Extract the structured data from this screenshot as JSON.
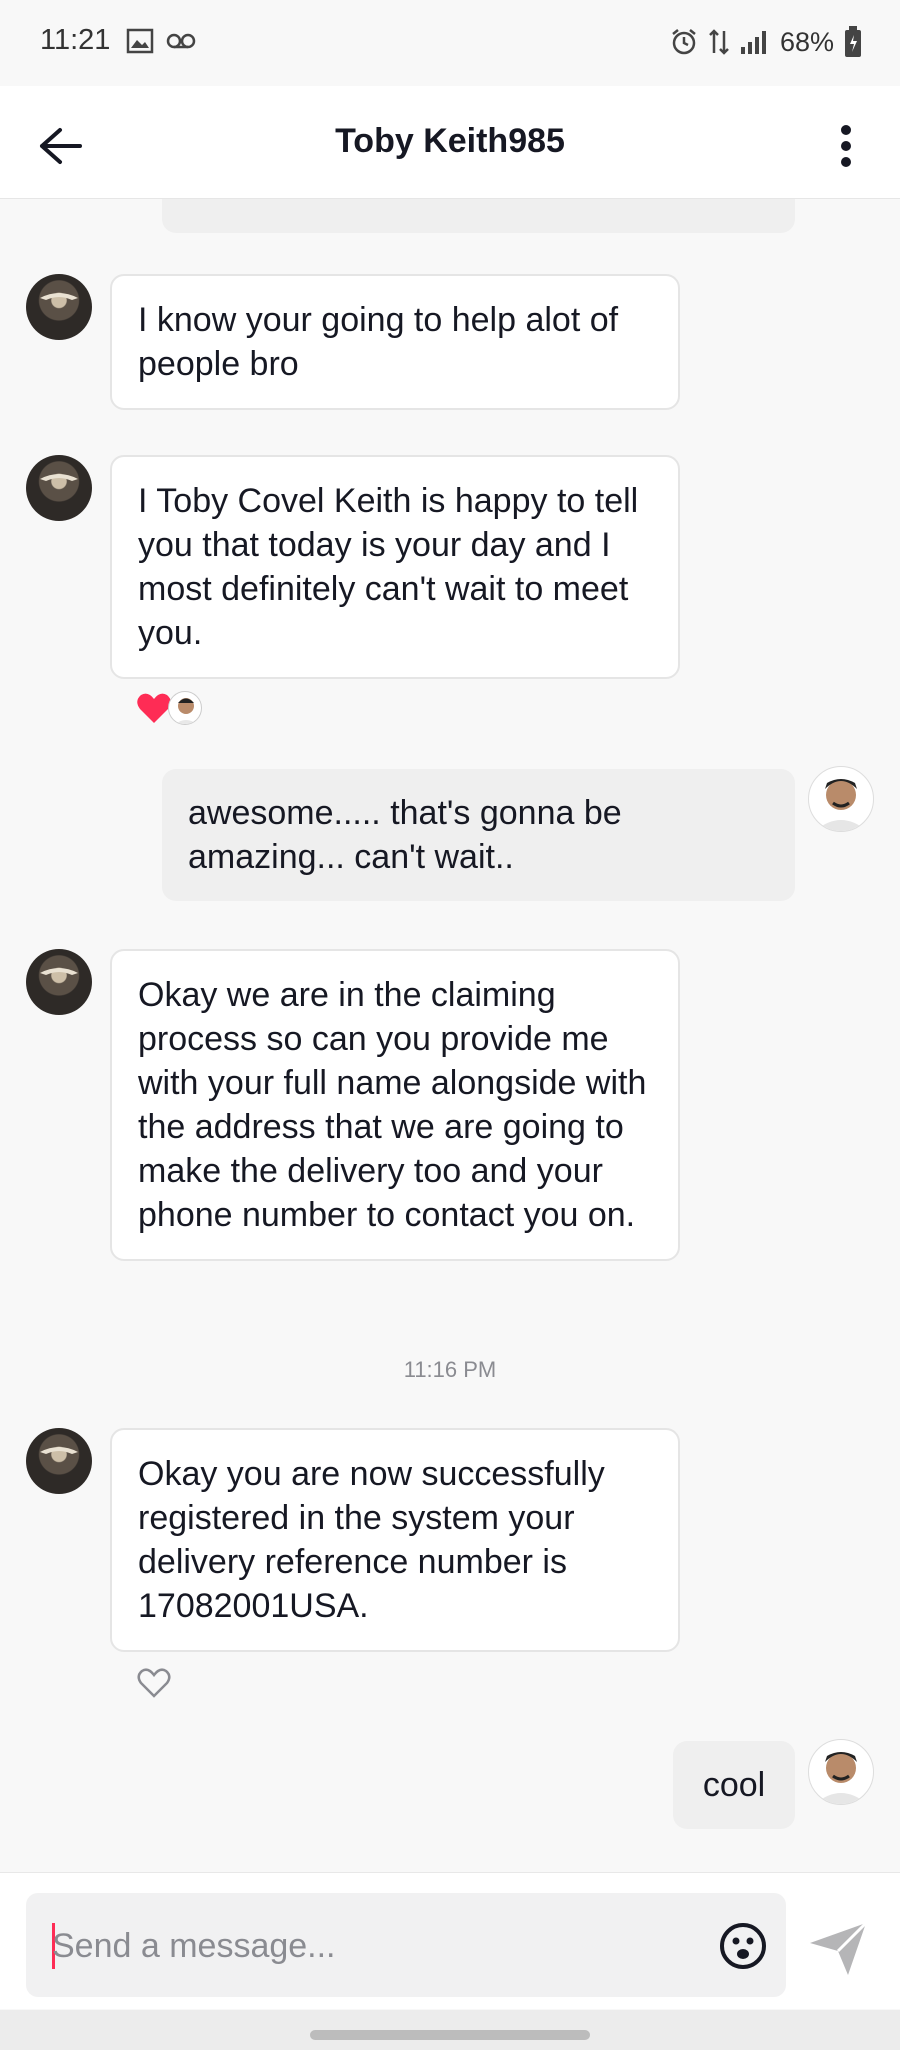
{
  "status_bar": {
    "time": "11:21",
    "battery": "68%",
    "icons": [
      "gallery-icon",
      "voicemail-icon",
      "alarm-icon",
      "data-icon",
      "signal-icon",
      "battery-icon"
    ]
  },
  "header": {
    "title": "Toby Keith985",
    "back_icon": "back-arrow-icon",
    "more_icon": "more-vertical-icon"
  },
  "messages": [
    {
      "id": "m0",
      "sender": "me",
      "text": ""
    },
    {
      "id": "m1",
      "sender": "toby",
      "text": "I know your going to help alot of people bro"
    },
    {
      "id": "m2",
      "sender": "toby",
      "text": "I Toby Covel Keith is happy to tell you that today is your day and I most definitely can't wait to meet you.",
      "reactions": [
        "heart-icon",
        "user-avatar"
      ]
    },
    {
      "id": "m3",
      "sender": "me",
      "text": "awesome..... that's gonna be amazing... can't wait.."
    },
    {
      "id": "m4",
      "sender": "toby",
      "text": "Okay we are in the claiming process so can you provide me with your full name alongside with the  address that we are going to make the delivery too and your phone number to contact you on."
    },
    {
      "id": "m5",
      "sender": "toby",
      "text": "Okay you are now successfully registered in the system your delivery reference number is 17082001USA."
    },
    {
      "id": "m6",
      "sender": "me",
      "text": "cool"
    }
  ],
  "timestamp": "11:16 PM",
  "composer": {
    "placeholder": "Send a message...",
    "emoji_icon": "emoji-icon",
    "send_icon": "send-icon"
  },
  "colors": {
    "accent": "#fe2c55",
    "heart": "#fe2c55",
    "incoming_bubble": "#ffffff",
    "outgoing_bubble": "#efefef"
  }
}
